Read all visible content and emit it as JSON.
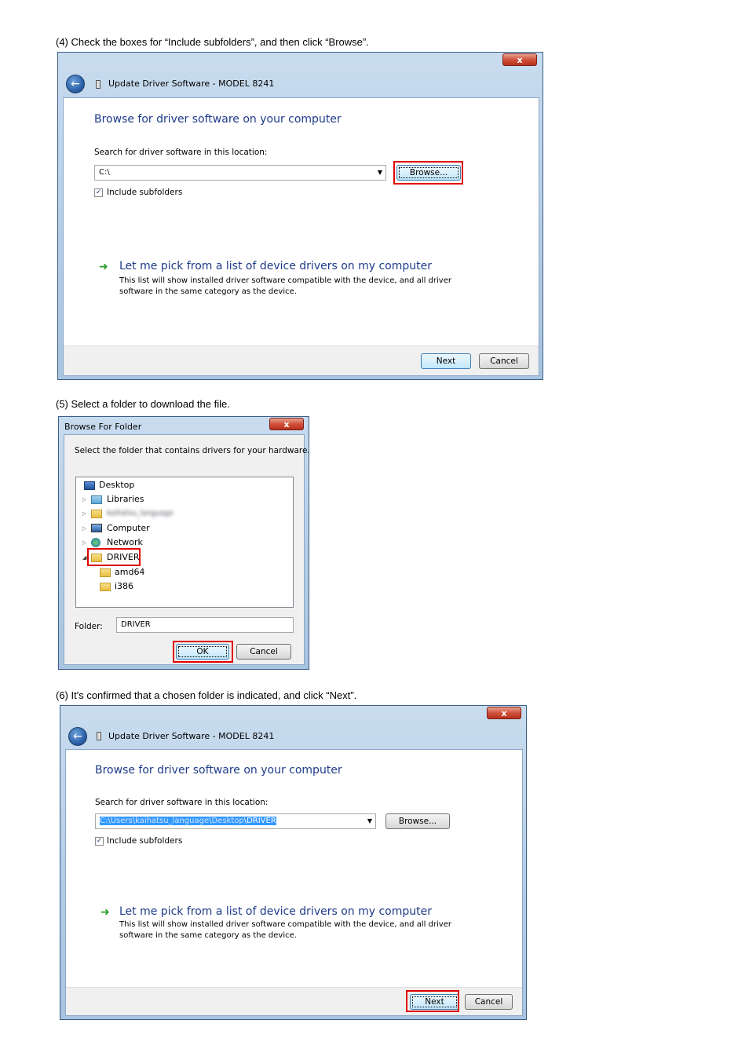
{
  "steps": {
    "step4": "(4)  Check the boxes for  “Include subfolders”, and then click “Browse”.",
    "step5": "(5)  Select a folder to download the file.",
    "step6": "(6)  It's confirmed that a chosen folder is indicated, and click “Next”."
  },
  "wizard1": {
    "title": "Update Driver Software - MODEL 8241",
    "heading": "Browse for driver software on your computer",
    "search_label": "Search for driver software in this location:",
    "location_value": "C:\\",
    "browse_label": "Browse...",
    "include_subfolders_label": "Include subfolders",
    "include_subfolders_checked": true,
    "pick_link_title": "Let me pick from a list of device drivers on my computer",
    "pick_link_desc_line1": "This list will show installed driver software compatible with the device, and all driver",
    "pick_link_desc_line2": "software in the same category as the device.",
    "next_label": "Next",
    "cancel_label": "Cancel",
    "close_glyph": "x"
  },
  "browse_dialog": {
    "title": "Browse For Folder",
    "instruction": "Select the folder that contains drivers for your hardware.",
    "tree": [
      {
        "label": "Desktop",
        "icon": "desktop-icon"
      },
      {
        "label": "Libraries",
        "icon": "libraries-icon"
      },
      {
        "label": "kaihatsu_language",
        "icon": "user-folder-icon"
      },
      {
        "label": "Computer",
        "icon": "computer-icon"
      },
      {
        "label": "Network",
        "icon": "network-icon"
      },
      {
        "label": "DRIVER",
        "icon": "folder-icon",
        "selected": true
      },
      {
        "label": "amd64",
        "icon": "folder-icon"
      },
      {
        "label": "i386",
        "icon": "folder-icon"
      }
    ],
    "folder_label": "Folder:",
    "folder_value": "DRIVER",
    "ok_label": "OK",
    "cancel_label": "Cancel",
    "close_glyph": "x"
  },
  "wizard2": {
    "title": "Update Driver Software - MODEL 8241",
    "heading": "Browse for driver software on your computer",
    "search_label": "Search for driver software in this location:",
    "location_value": "C:\\Users\\kaihatsu_language\\Desktop\\DRIVER",
    "location_prefix": "C:\\Users\\kaihatsu_language\\Desktop",
    "location_suffix": "\\DRIVER",
    "browse_label": "Browse...",
    "include_subfolders_label": "Include subfolders",
    "include_subfolders_checked": true,
    "pick_link_title": "Let me pick from a list of device drivers on my computer",
    "pick_link_desc_line1": "This list will show installed driver software compatible with the device, and all driver",
    "pick_link_desc_line2": "software in the same category as the device.",
    "next_label": "Next",
    "cancel_label": "Cancel",
    "close_glyph": "x"
  },
  "colors": {
    "highlight": "#e00000",
    "heading_blue": "#1e3b8a",
    "selection": "#3399ff"
  }
}
